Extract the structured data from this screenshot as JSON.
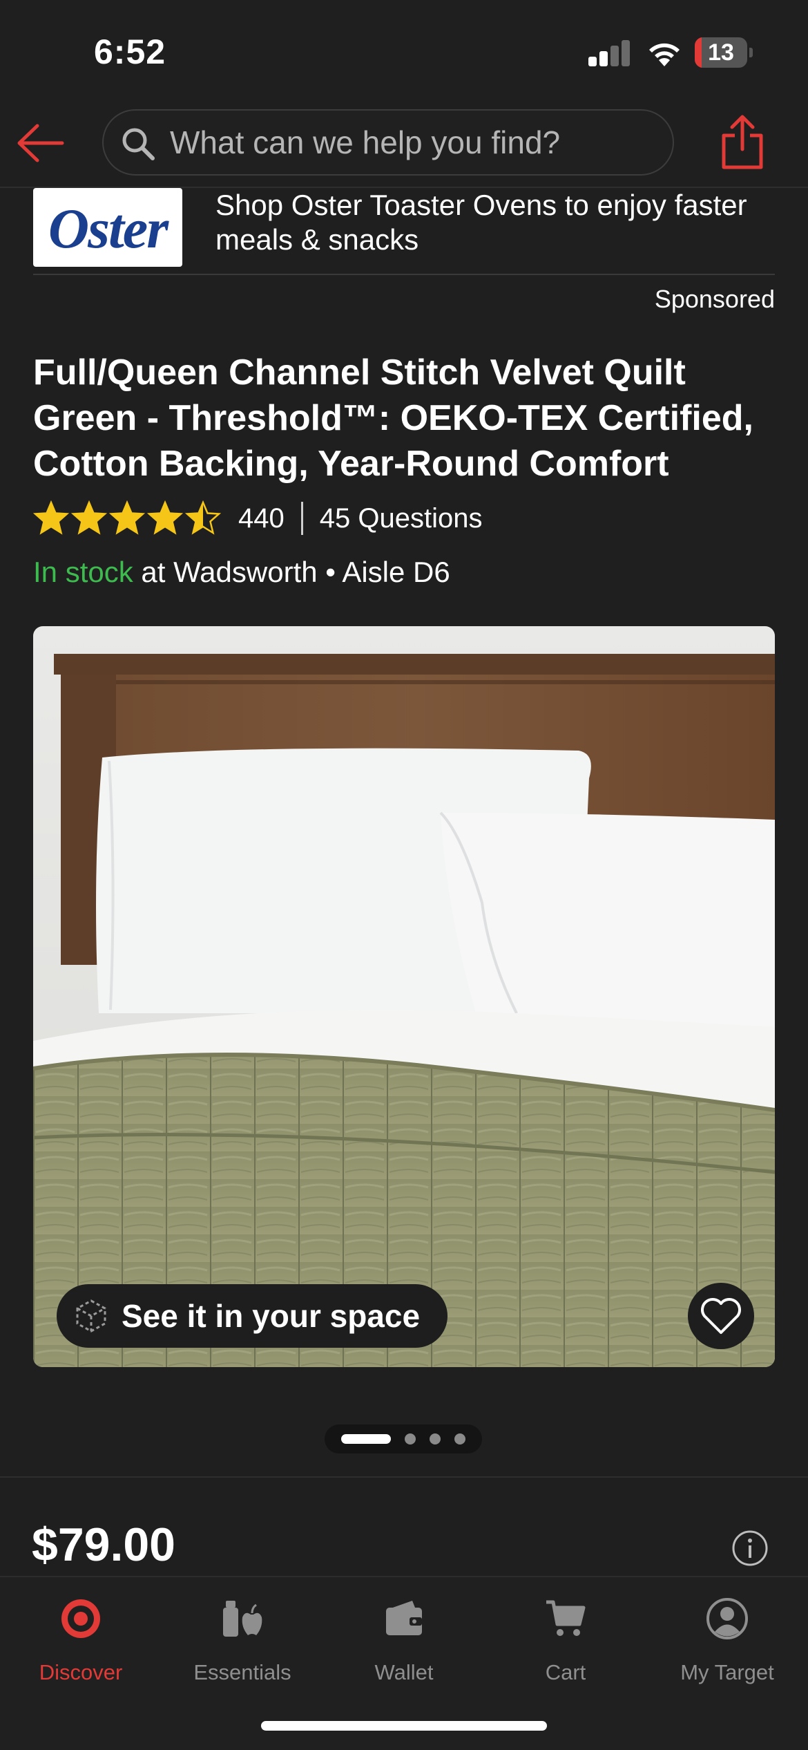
{
  "status_bar": {
    "time": "6:52",
    "battery": "13",
    "battery_level": 0.13
  },
  "search": {
    "placeholder": "What can we help you find?"
  },
  "ad": {
    "logo_text": "Oster",
    "text": "Shop Oster Toaster Ovens to enjoy faster meals & snacks",
    "sponsored_label": "Sponsored"
  },
  "product": {
    "title": "Full/Queen Channel Stitch Velvet Quilt Green - Threshold™: OEKO-TEX Certified, Cotton Backing, Year-Round Comfort",
    "rating": 4.5,
    "rating_max": 5,
    "rating_count": "440",
    "questions": "45 Questions",
    "stock_status": "In stock",
    "stock_location": " at Wadsworth • Aisle D6",
    "price": "$79.00"
  },
  "image": {
    "ar_button_label": "See it in your space",
    "carousel_total": 4,
    "carousel_active_index": 0
  },
  "tabs": [
    {
      "label": "Discover",
      "icon": "discover-icon",
      "active": true
    },
    {
      "label": "Essentials",
      "icon": "essentials-icon",
      "active": false
    },
    {
      "label": "Wallet",
      "icon": "wallet-icon",
      "active": false
    },
    {
      "label": "Cart",
      "icon": "cart-icon",
      "active": false
    },
    {
      "label": "My Target",
      "icon": "account-icon",
      "active": false
    }
  ],
  "colors": {
    "accent": "#e23a36",
    "in_stock": "#3dbb4f",
    "star": "#f5c518",
    "background": "#1f1f1f"
  }
}
